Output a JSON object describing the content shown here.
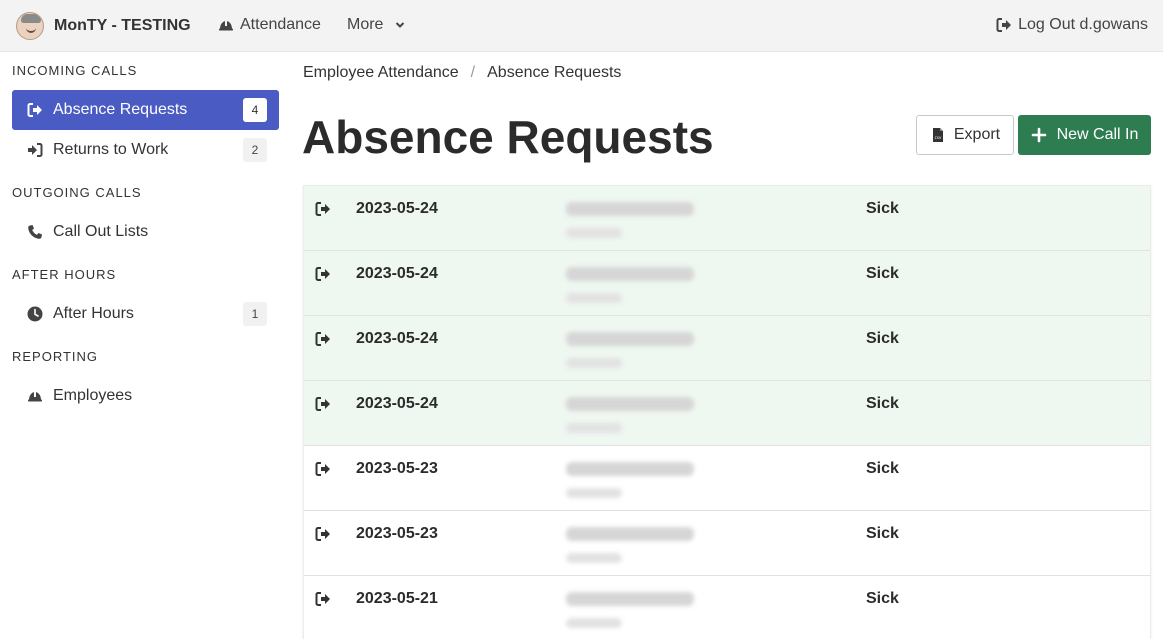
{
  "app": {
    "title": "MonTY - TESTING"
  },
  "nav": {
    "attendance_label": "Attendance",
    "more_label": "More",
    "logout_label": "Log Out d.gowans"
  },
  "sidebar": {
    "sections": [
      {
        "heading": "INCOMING CALLS"
      },
      {
        "heading": "OUTGOING CALLS"
      },
      {
        "heading": "AFTER HOURS"
      },
      {
        "heading": "REPORTING"
      }
    ],
    "items": [
      {
        "label": "Absence Requests",
        "count": "4",
        "icon": "sign-out-icon",
        "active": true
      },
      {
        "label": "Returns to Work",
        "count": "2",
        "icon": "sign-in-icon"
      },
      {
        "label": "Call Out Lists",
        "icon": "phone-icon"
      },
      {
        "label": "After Hours",
        "count": "1",
        "icon": "clock-icon"
      },
      {
        "label": "Employees",
        "icon": "hard-hat-icon"
      }
    ]
  },
  "breadcrumb": {
    "parent": "Employee Attendance",
    "separator": "/",
    "current": "Absence Requests"
  },
  "page": {
    "title": "Absence Requests"
  },
  "actions": {
    "export_label": "Export",
    "new_label": "New Call In"
  },
  "colors": {
    "accent": "#4a5bc4",
    "success": "#2e7d50",
    "new_row": "#eff7f1"
  },
  "requests": [
    {
      "date": "2023-05-24",
      "reason": "Sick",
      "highlighted": true
    },
    {
      "date": "2023-05-24",
      "reason": "Sick",
      "highlighted": true
    },
    {
      "date": "2023-05-24",
      "reason": "Sick",
      "highlighted": true
    },
    {
      "date": "2023-05-24",
      "reason": "Sick",
      "highlighted": true
    },
    {
      "date": "2023-05-23",
      "reason": "Sick",
      "highlighted": false
    },
    {
      "date": "2023-05-23",
      "reason": "Sick",
      "highlighted": false
    },
    {
      "date": "2023-05-21",
      "reason": "Sick",
      "highlighted": false
    }
  ]
}
